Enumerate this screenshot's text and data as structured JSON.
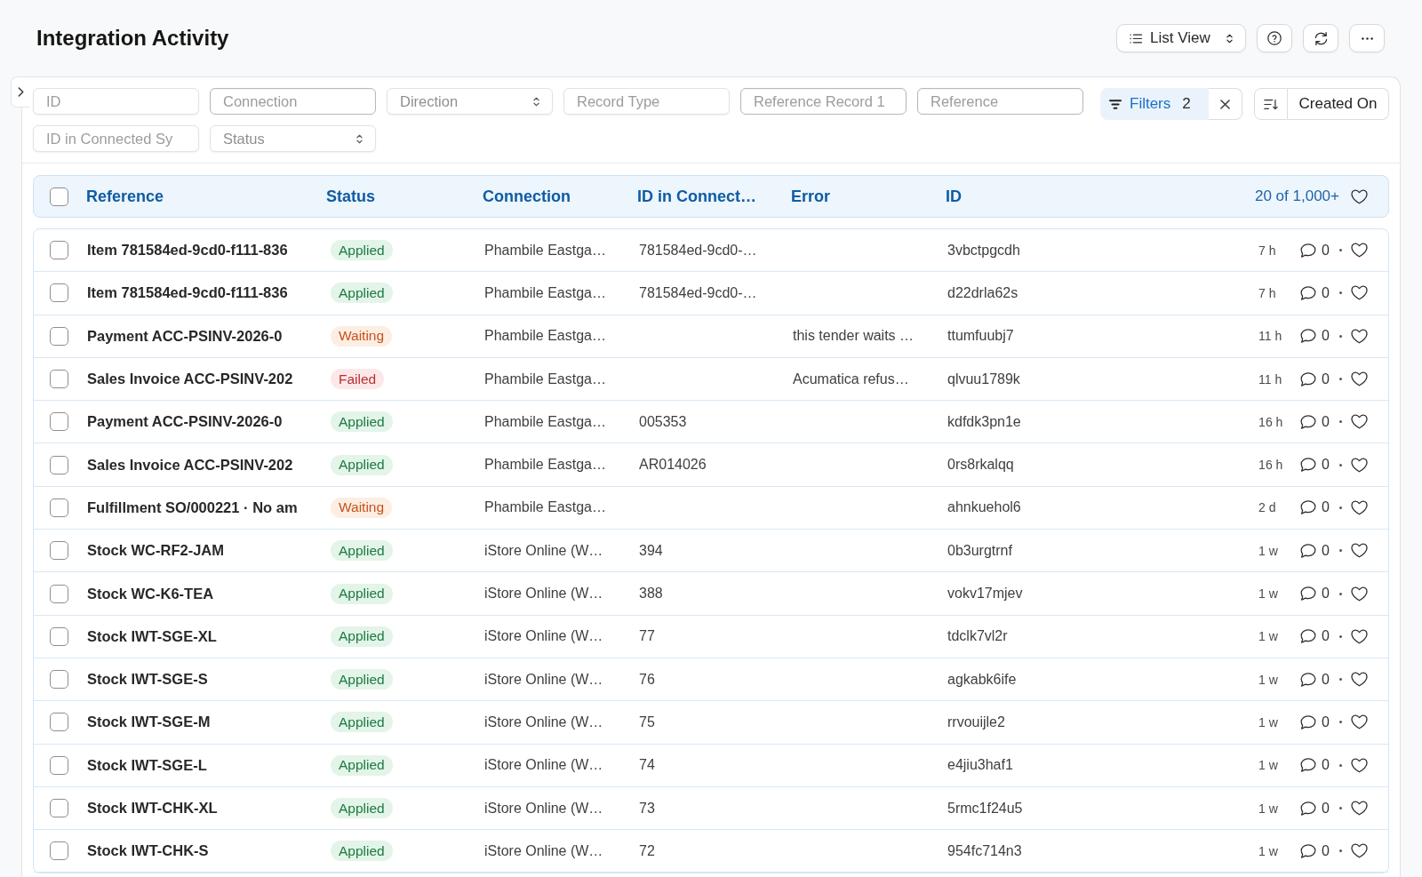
{
  "page": {
    "title": "Integration Activity"
  },
  "toolbar": {
    "view_switcher": "List View"
  },
  "filters": {
    "fields": [
      {
        "placeholder": "ID",
        "kind": "text"
      },
      {
        "placeholder": "Connection",
        "kind": "outlined"
      },
      {
        "placeholder": "Direction",
        "kind": "select"
      },
      {
        "placeholder": "Record Type",
        "kind": "text"
      },
      {
        "placeholder": "Reference Record 1",
        "kind": "outlined"
      },
      {
        "placeholder": "Reference",
        "kind": "outlined"
      },
      {
        "placeholder": "ID in Connected Sy",
        "kind": "text"
      },
      {
        "placeholder": "Status",
        "kind": "select"
      }
    ],
    "filter_button": {
      "label": "Filters",
      "count": "2"
    },
    "sort_button": {
      "label": "Created On"
    }
  },
  "table": {
    "select_all": {
      "checked": false
    },
    "columns": [
      "Reference",
      "Status",
      "Connection",
      "ID in Connect…",
      "Error",
      "ID"
    ],
    "count": "20 of 1,000+",
    "liked_only": false,
    "rows": [
      {
        "checked": false,
        "reference": "Item 781584ed-9cd0-f111-836",
        "status": {
          "label": "Applied",
          "kind": "success"
        },
        "connection": "Phambile Eastga…",
        "id_in_connect": "781584ed-9cd0-…",
        "id": "3vbctpgcdh",
        "column_7": "7 h",
        "comments": "0",
        "liked": false
      },
      {
        "checked": false,
        "reference": "Item 781584ed-9cd0-f111-836",
        "status": {
          "label": "Applied",
          "kind": "success"
        },
        "connection": "Phambile Eastga…",
        "id_in_connect": "781584ed-9cd0-…",
        "id": "d22drla62s",
        "column_7": "7 h",
        "comments": "0",
        "liked": false
      },
      {
        "checked": false,
        "reference": "Payment ACC-PSINV-2026-0",
        "status": {
          "label": "Waiting",
          "kind": "warning"
        },
        "connection": "Phambile Eastga…",
        "error": "this tender waits …",
        "id": "ttumfuubj7",
        "column_7": "11 h",
        "comments": "0",
        "liked": false
      },
      {
        "checked": false,
        "reference": "Sales Invoice ACC-PSINV-202",
        "status": {
          "label": "Failed",
          "kind": "danger"
        },
        "connection": "Phambile Eastga…",
        "error": "Acumatica refus…",
        "id": "qlvuu1789k",
        "column_7": "11 h",
        "comments": "0",
        "liked": false
      },
      {
        "checked": false,
        "reference": "Payment ACC-PSINV-2026-0",
        "status": {
          "label": "Applied",
          "kind": "success"
        },
        "connection": "Phambile Eastga…",
        "id_in_connect": "005353",
        "id": "kdfdk3pn1e",
        "column_7": "16 h",
        "comments": "0",
        "liked": false
      },
      {
        "checked": false,
        "reference": "Sales Invoice ACC-PSINV-202",
        "status": {
          "label": "Applied",
          "kind": "success"
        },
        "connection": "Phambile Eastga…",
        "id_in_connect": "AR014026",
        "id": "0rs8rkalqq",
        "column_7": "16 h",
        "comments": "0",
        "liked": false
      },
      {
        "checked": false,
        "reference": "Fulfillment SO/000221 · No am",
        "status": {
          "label": "Waiting",
          "kind": "warning"
        },
        "connection": "Phambile Eastga…",
        "id": "ahnkuehol6",
        "column_7": "2 d",
        "comments": "0",
        "liked": false
      },
      {
        "checked": false,
        "reference": "Stock WC-RF2-JAM",
        "status": {
          "label": "Applied",
          "kind": "success"
        },
        "connection": "iStore Online (W…",
        "id_in_connect": "394",
        "id": "0b3urgtrnf",
        "column_7": "1 w",
        "comments": "0",
        "liked": false
      },
      {
        "checked": false,
        "reference": "Stock WC-K6-TEA",
        "status": {
          "label": "Applied",
          "kind": "success"
        },
        "connection": "iStore Online (W…",
        "id_in_connect": "388",
        "id": "vokv17mjev",
        "column_7": "1 w",
        "comments": "0",
        "liked": false
      },
      {
        "checked": false,
        "reference": "Stock IWT-SGE-XL",
        "status": {
          "label": "Applied",
          "kind": "success"
        },
        "connection": "iStore Online (W…",
        "id_in_connect": "77",
        "id": "tdclk7vl2r",
        "column_7": "1 w",
        "comments": "0",
        "liked": false
      },
      {
        "checked": false,
        "reference": "Stock IWT-SGE-S",
        "status": {
          "label": "Applied",
          "kind": "success"
        },
        "connection": "iStore Online (W…",
        "id_in_connect": "76",
        "id": "agkabk6ife",
        "column_7": "1 w",
        "comments": "0",
        "liked": false
      },
      {
        "checked": false,
        "reference": "Stock IWT-SGE-M",
        "status": {
          "label": "Applied",
          "kind": "success"
        },
        "connection": "iStore Online (W…",
        "id_in_connect": "75",
        "id": "rrvouijle2",
        "column_7": "1 w",
        "comments": "0",
        "liked": false
      },
      {
        "checked": false,
        "reference": "Stock IWT-SGE-L",
        "status": {
          "label": "Applied",
          "kind": "success"
        },
        "connection": "iStore Online (W…",
        "id_in_connect": "74",
        "id": "e4jiu3haf1",
        "column_7": "1 w",
        "comments": "0",
        "liked": false
      },
      {
        "checked": false,
        "reference": "Stock IWT-CHK-XL",
        "status": {
          "label": "Applied",
          "kind": "success"
        },
        "connection": "iStore Online (W…",
        "id_in_connect": "73",
        "id": "5rmc1f24u5",
        "column_7": "1 w",
        "comments": "0",
        "liked": false
      },
      {
        "checked": false,
        "reference": "Stock IWT-CHK-S",
        "status": {
          "label": "Applied",
          "kind": "success"
        },
        "connection": "iStore Online (W…",
        "id_in_connect": "72",
        "id": "954fc714n3",
        "column_7": "1 w",
        "comments": "0",
        "liked": false
      }
    ]
  }
}
